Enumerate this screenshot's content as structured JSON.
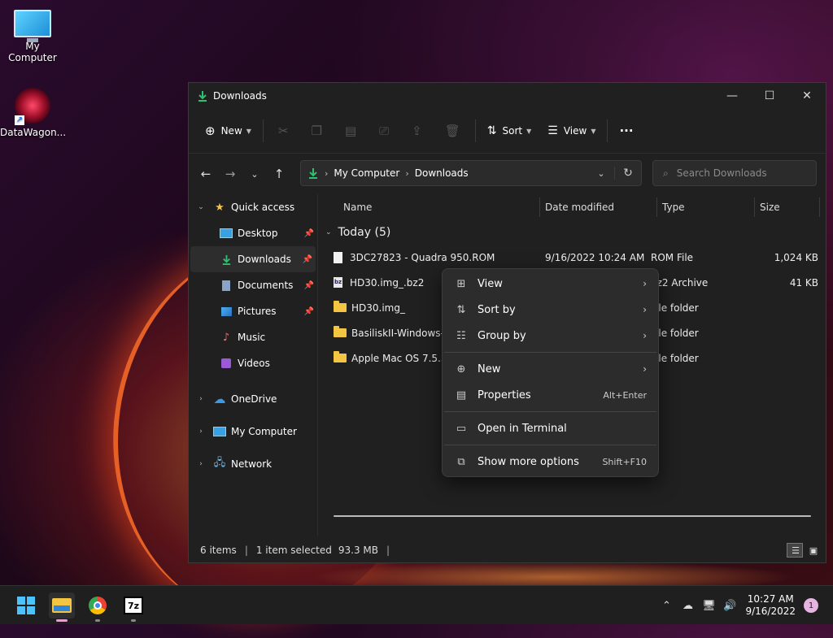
{
  "desktop": {
    "icons": [
      {
        "label": "My Computer",
        "icon": "monitor-icon"
      },
      {
        "label": "DataWagon...",
        "icon": "datawagon-icon"
      }
    ]
  },
  "window": {
    "title": "Downloads",
    "controls": {
      "minimize": "—",
      "maximize": "☐",
      "close": "✕"
    }
  },
  "toolbar": {
    "new_label": "New",
    "sort_label": "Sort",
    "view_label": "View",
    "more_label": "···"
  },
  "address": {
    "segments": [
      "My Computer",
      "Downloads"
    ]
  },
  "search": {
    "placeholder": "Search Downloads"
  },
  "sidebar": {
    "quick_access": "Quick access",
    "items": [
      {
        "label": "Desktop",
        "icon": "desktop-icon",
        "pinned": true
      },
      {
        "label": "Downloads",
        "icon": "download-icon",
        "pinned": true,
        "selected": true
      },
      {
        "label": "Documents",
        "icon": "documents-icon",
        "pinned": true
      },
      {
        "label": "Pictures",
        "icon": "pictures-icon",
        "pinned": true
      },
      {
        "label": "Music",
        "icon": "music-icon",
        "pinned": false
      },
      {
        "label": "Videos",
        "icon": "videos-icon",
        "pinned": false
      }
    ],
    "roots": [
      {
        "label": "OneDrive",
        "icon": "cloud-icon"
      },
      {
        "label": "My Computer",
        "icon": "monitor-icon"
      },
      {
        "label": "Network",
        "icon": "network-icon"
      }
    ]
  },
  "columns": {
    "name": "Name",
    "date": "Date modified",
    "type": "Type",
    "size": "Size"
  },
  "group": {
    "label": "Today (5)"
  },
  "files": [
    {
      "name": "3DC27823 - Quadra 950.ROM",
      "date": "9/16/2022 10:24 AM",
      "type": "ROM File",
      "size": "1,024 KB",
      "icon": "file"
    },
    {
      "name": "HD30.img_.bz2",
      "date": "",
      "type": "bz2 Archive",
      "size": "41 KB",
      "icon": "bz"
    },
    {
      "name": "HD30.img_",
      "date": "",
      "type": "File folder",
      "size": "",
      "icon": "folder"
    },
    {
      "name": "BasiliskII-Windows-12",
      "date": "",
      "type": "File folder",
      "size": "",
      "icon": "folder"
    },
    {
      "name": "Apple Mac OS 7.5.3",
      "date": "",
      "type": "File folder",
      "size": "",
      "icon": "folder"
    }
  ],
  "status": {
    "count": "6 items",
    "selected": "1 item selected",
    "size": "93.3 MB"
  },
  "context_menu": {
    "view": "View",
    "sort_by": "Sort by",
    "group_by": "Group by",
    "new": "New",
    "properties": "Properties",
    "properties_shortcut": "Alt+Enter",
    "open_terminal": "Open in Terminal",
    "more_options": "Show more options",
    "more_options_shortcut": "Shift+F10"
  },
  "taskbar": {
    "time": "10:27 AM",
    "date": "9/16/2022",
    "notifications": "1",
    "sevenzip_label": "7z"
  },
  "colors": {
    "accent": "#4cc2ff",
    "folder": "#f4c542",
    "download_green": "#2fbf71"
  }
}
